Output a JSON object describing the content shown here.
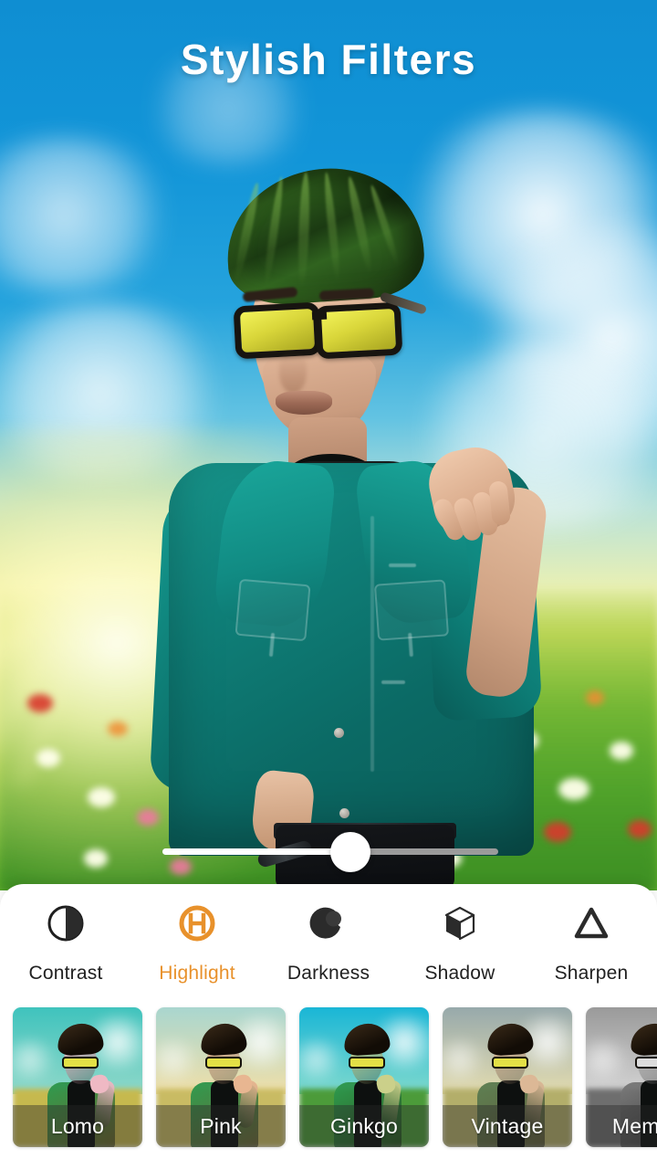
{
  "header": {
    "title": "Stylish Filters"
  },
  "photo": {
    "subject_description": "Stylized portrait of young man with green pompadour hair, yellow sunglasses and teal denim jacket",
    "background_description": "Blurred sunlit flower meadow under blue sky with clouds",
    "sky_color": "#1295d8",
    "grass_color": "#86c23a",
    "jacket_color": "#0f7f78",
    "hair_color": "#2d5c1c",
    "lens_color": "#e3e046"
  },
  "slider": {
    "name": "intensity-slider",
    "value": 56,
    "min": 0,
    "max": 100,
    "fill_color": "#ffffff",
    "track_color": "#9b9b9b"
  },
  "tools": {
    "active_color": "#E8912B",
    "inactive_color": "#212121",
    "items": [
      {
        "label": "Contrast",
        "icon": "contrast-icon",
        "active": false
      },
      {
        "label": "Highlight",
        "icon": "highlight-icon",
        "active": true
      },
      {
        "label": "Darkness",
        "icon": "darkness-icon",
        "active": false
      },
      {
        "label": "Shadow",
        "icon": "shadow-cube-icon",
        "active": false
      },
      {
        "label": "Sharpen",
        "icon": "sharpen-icon",
        "active": false
      }
    ]
  },
  "filters": {
    "items": [
      {
        "label": "Lomo",
        "sky": "#3fc3bd",
        "sky2": "#8fd8c9",
        "ground": "#c6b94e",
        "skin": "#efb9c4",
        "jacket": "#2f9b4e",
        "selected": false
      },
      {
        "label": "Pink",
        "sky": "#a9d6cf",
        "sky2": "#f0dfa8",
        "ground": "#c9bb63",
        "skin": "#e8b691",
        "jacket": "#2f9b4e",
        "selected": false
      },
      {
        "label": "Ginkgo",
        "sky": "#19b6d6",
        "sky2": "#7fd9cd",
        "ground": "#4c9b3a",
        "skin": "#cbd08a",
        "jacket": "#2f9b4e",
        "selected": false
      },
      {
        "label": "Vintage",
        "sky": "#97a9ab",
        "sky2": "#e3dcb0",
        "ground": "#b3ae6a",
        "skin": "#dcb896",
        "jacket": "#5d7f52",
        "selected": false
      },
      {
        "label": "Memory",
        "sky": "#9a9a9a",
        "sky2": "#d4d4d4",
        "ground": "#6e6e6e",
        "skin": "#c4c4c4",
        "jacket": "#7a7a7a",
        "selected": false
      }
    ]
  }
}
